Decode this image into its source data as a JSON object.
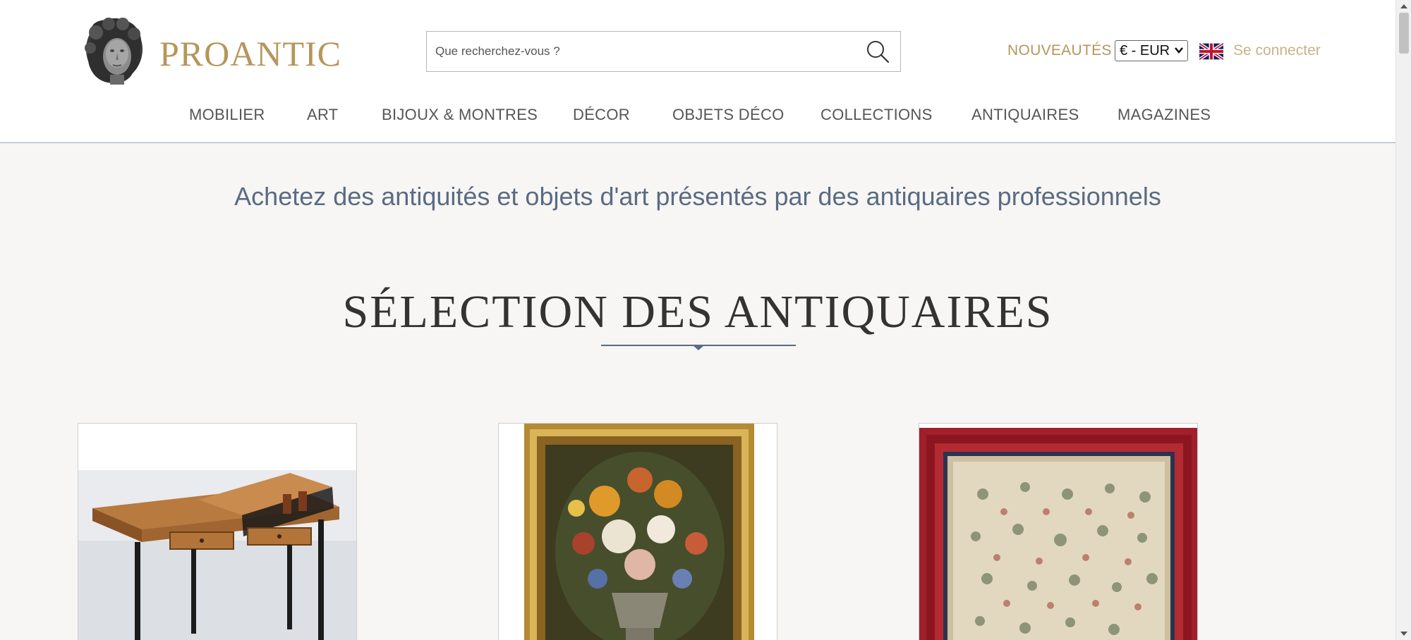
{
  "header": {
    "logo_text": "PROANTIC",
    "search_placeholder": "Que recherchez-vous ?",
    "new_label": "NOUVEAUTÉS",
    "currency_value": "€ - EUR",
    "login_label": "Se connecter"
  },
  "nav": {
    "items": [
      {
        "label": "MOBILIER"
      },
      {
        "label": "ART"
      },
      {
        "label": "BIJOUX & MONTRES"
      },
      {
        "label": "DÉCOR"
      },
      {
        "label": "OBJETS DÉCO"
      },
      {
        "label": "COLLECTIONS"
      },
      {
        "label": "ANTIQUAIRES"
      },
      {
        "label": "MAGAZINES"
      }
    ]
  },
  "main": {
    "tagline": "Achetez des antiquités et objets d'art présentés par des antiquaires professionnels",
    "section_title": "SÉLECTION DES ANTIQUAIRES"
  },
  "colors": {
    "gold": "#b5965b",
    "nav_text": "#555555",
    "tagline": "#5a6b82",
    "background": "#f7f6f5"
  },
  "icons": [
    "search-icon",
    "flag-uk-icon",
    "chevron-down-icon"
  ]
}
